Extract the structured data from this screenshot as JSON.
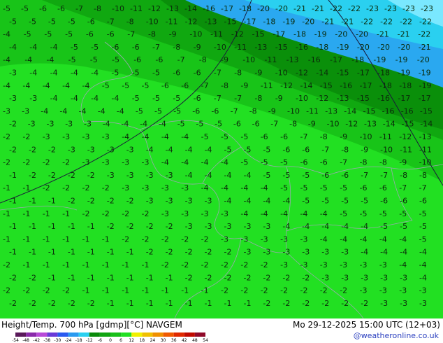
{
  "footer": {
    "title": "Height/Temp. 700 hPa [gdmp][°C] NAVGEM",
    "valid": "Mo 29-12-2025 15:00 UTC (12+03)",
    "credit": "@weatheronline.co.uk"
  },
  "colorbar": {
    "ticks": [
      "-54",
      "-48",
      "-42",
      "-38",
      "-30",
      "-24",
      "-18",
      "-12",
      "-6",
      "0",
      "6",
      "12",
      "18",
      "24",
      "30",
      "36",
      "42",
      "48",
      "54"
    ],
    "colors": [
      "#5a1a5a",
      "#8a2aaa",
      "#b84ad8",
      "#6a3ad8",
      "#2a5af0",
      "#2a9af0",
      "#2ad0f0",
      "#0a8a0a",
      "#11a511",
      "#19c019",
      "#22e022",
      "#f0f000",
      "#f0c000",
      "#f09000",
      "#f05a00",
      "#e02a00",
      "#c00a00",
      "#900a2a"
    ]
  },
  "map": {
    "colors": {
      "green_light": "#22e022",
      "green_mid": "#18c418",
      "green_dark": "#10a810",
      "green_darker": "#0a8f0a",
      "cyan_light": "#7ae8ff",
      "cyan": "#2ad0f0",
      "blue": "#2aa8f0",
      "border": "#9aa8b0",
      "contour": "#1a1a3a"
    },
    "temperature_rows": [
      {
        "values": [
          "-5",
          "-5",
          "-6",
          "-6",
          "-7",
          "-8",
          "-10",
          "-11",
          "-12",
          "-13",
          "-14",
          "-16",
          "-17",
          "-18",
          "-20",
          "-20",
          "-21",
          "-21",
          "-22",
          "-22",
          "-23",
          "-23",
          "-23",
          "-23"
        ]
      },
      {
        "values": [
          "-5",
          "-5",
          "-5",
          "-5",
          "-6",
          "-7",
          "-8",
          "-10",
          "-11",
          "-12",
          "-13",
          "-15",
          "-17",
          "-18",
          "-19",
          "-20",
          "-21",
          "-21",
          "-22",
          "-22",
          "-22",
          "-22"
        ]
      },
      {
        "values": [
          "-4",
          "-5",
          "-5",
          "-5",
          "-6",
          "-6",
          "-7",
          "-8",
          "-9",
          "-10",
          "-11",
          "-12",
          "-15",
          "-17",
          "-18",
          "-19",
          "-20",
          "-20",
          "-21",
          "-21",
          "-22"
        ]
      },
      {
        "values": [
          "-4",
          "-4",
          "-4",
          "-5",
          "-5",
          "-6",
          "-6",
          "-7",
          "-8",
          "-9",
          "-10",
          "-11",
          "-13",
          "-15",
          "-16",
          "-18",
          "-19",
          "-20",
          "-20",
          "-20",
          "-21"
        ]
      },
      {
        "values": [
          "-4",
          "-4",
          "-4",
          "-5",
          "-5",
          "-5",
          "-6",
          "-6",
          "-7",
          "-8",
          "-9",
          "-10",
          "-11",
          "-13",
          "-16",
          "-17",
          "-18",
          "-19",
          "-19",
          "-20"
        ]
      },
      {
        "values": [
          "-3",
          "-4",
          "-4",
          "-4",
          "-4",
          "-5",
          "-5",
          "-5",
          "-6",
          "-6",
          "-7",
          "-8",
          "-9",
          "-10",
          "-12",
          "-14",
          "-15",
          "-17",
          "-18",
          "-19",
          "-19"
        ]
      },
      {
        "values": [
          "-4",
          "-4",
          "-4",
          "-4",
          "-4",
          "-5",
          "-5",
          "-5",
          "-6",
          "-6",
          "-7",
          "-8",
          "-9",
          "-11",
          "-12",
          "-14",
          "-15",
          "-16",
          "-17",
          "-18",
          "-18",
          "-19"
        ]
      },
      {
        "values": [
          "-3",
          "-3",
          "-4",
          "-4",
          "-4",
          "-4",
          "-5",
          "-5",
          "-5",
          "-6",
          "-7",
          "-7",
          "-8",
          "-9",
          "-10",
          "-12",
          "-13",
          "-15",
          "-16",
          "-17",
          "-17"
        ]
      },
      {
        "values": [
          "-3",
          "-3",
          "-4",
          "-4",
          "-4",
          "-4",
          "-4",
          "-5",
          "-5",
          "-5",
          "-6",
          "-6",
          "-7",
          "-8",
          "-9",
          "-10",
          "-11",
          "-13",
          "-14",
          "-15",
          "-16",
          "-16",
          "-15"
        ]
      },
      {
        "values": [
          "-2",
          "-3",
          "-3",
          "-3",
          "-3",
          "-4",
          "-4",
          "-4",
          "-4",
          "-5",
          "-5",
          "-5",
          "-6",
          "-6",
          "-7",
          "-8",
          "-9",
          "-10",
          "-12",
          "-13",
          "-14",
          "-15",
          "-14"
        ]
      },
      {
        "values": [
          "-2",
          "-2",
          "-3",
          "-3",
          "-3",
          "-3",
          "-4",
          "-4",
          "-4",
          "-4",
          "-5",
          "-5",
          "-5",
          "-6",
          "-6",
          "-7",
          "-8",
          "-9",
          "-10",
          "-11",
          "-12",
          "-13"
        ]
      },
      {
        "values": [
          "-2",
          "-2",
          "-2",
          "-3",
          "-3",
          "-3",
          "-3",
          "-4",
          "-4",
          "-4",
          "-4",
          "-5",
          "-5",
          "-5",
          "-6",
          "-6",
          "-7",
          "-8",
          "-9",
          "-10",
          "-11",
          "-11"
        ]
      },
      {
        "values": [
          "-2",
          "-2",
          "-2",
          "-2",
          "-3",
          "-3",
          "-3",
          "-3",
          "-4",
          "-4",
          "-4",
          "-4",
          "-5",
          "-5",
          "-5",
          "-6",
          "-6",
          "-7",
          "-8",
          "-8",
          "-9",
          "-10"
        ]
      },
      {
        "values": [
          "-1",
          "-2",
          "-2",
          "-2",
          "-2",
          "-3",
          "-3",
          "-3",
          "-3",
          "-4",
          "-4",
          "-4",
          "-4",
          "-5",
          "-5",
          "-5",
          "-6",
          "-6",
          "-7",
          "-7",
          "-8",
          "-8"
        ]
      },
      {
        "values": [
          "-1",
          "-1",
          "-2",
          "-2",
          "-2",
          "-2",
          "-3",
          "-3",
          "-3",
          "-3",
          "-4",
          "-4",
          "-4",
          "-4",
          "-5",
          "-5",
          "-5",
          "-5",
          "-6",
          "-6",
          "-7",
          "-7"
        ]
      },
      {
        "values": [
          "-1",
          "-1",
          "-1",
          "-2",
          "-2",
          "-2",
          "-2",
          "-3",
          "-3",
          "-3",
          "-3",
          "-4",
          "-4",
          "-4",
          "-4",
          "-5",
          "-5",
          "-5",
          "-5",
          "-6",
          "-6",
          "-6"
        ]
      },
      {
        "values": [
          "-1",
          "-1",
          "-1",
          "-1",
          "-2",
          "-2",
          "-2",
          "-2",
          "-3",
          "-3",
          "-3",
          "-3",
          "-4",
          "-4",
          "-4",
          "-4",
          "-4",
          "-5",
          "-5",
          "-5",
          "-5",
          "-5"
        ]
      },
      {
        "values": [
          "-1",
          "-1",
          "-1",
          "-1",
          "-1",
          "-2",
          "-2",
          "-2",
          "-2",
          "-3",
          "-3",
          "-3",
          "-3",
          "-3",
          "-4",
          "-4",
          "-4",
          "-4",
          "-4",
          "-5",
          "-5",
          "-5"
        ]
      },
      {
        "values": [
          "-1",
          "-1",
          "-1",
          "-1",
          "-1",
          "-1",
          "-2",
          "-2",
          "-2",
          "-2",
          "-2",
          "-3",
          "-3",
          "-3",
          "-3",
          "-3",
          "-4",
          "-4",
          "-4",
          "-4",
          "-4",
          "-5"
        ]
      },
      {
        "values": [
          "-1",
          "-1",
          "-1",
          "-1",
          "-1",
          "-1",
          "-1",
          "-2",
          "-2",
          "-2",
          "-2",
          "-2",
          "-3",
          "-3",
          "-3",
          "-3",
          "-3",
          "-3",
          "-4",
          "-4",
          "-4",
          "-4"
        ]
      },
      {
        "values": [
          "-2",
          "-1",
          "-1",
          "-1",
          "-1",
          "-1",
          "-1",
          "-1",
          "-2",
          "-2",
          "-2",
          "-2",
          "-2",
          "-2",
          "-3",
          "-3",
          "-3",
          "-3",
          "-3",
          "-3",
          "-4",
          "-4"
        ]
      },
      {
        "values": [
          "-2",
          "-2",
          "-1",
          "-1",
          "-1",
          "-1",
          "-1",
          "-1",
          "-1",
          "-2",
          "-2",
          "-2",
          "-2",
          "-2",
          "-2",
          "-2",
          "-3",
          "-3",
          "-3",
          "-3",
          "-3",
          "-4"
        ]
      },
      {
        "values": [
          "-2",
          "-2",
          "-2",
          "-2",
          "-1",
          "-1",
          "-1",
          "-1",
          "-1",
          "-1",
          "-1",
          "-2",
          "-2",
          "-2",
          "-2",
          "-2",
          "-2",
          "-2",
          "-3",
          "-3",
          "-3",
          "-3"
        ]
      },
      {
        "values": [
          "-2",
          "-2",
          "-2",
          "-2",
          "-2",
          "-1",
          "-1",
          "-1",
          "-1",
          "-1",
          "-1",
          "-1",
          "-1",
          "-2",
          "-2",
          "-2",
          "-2",
          "-2",
          "-2",
          "-3",
          "-3",
          "-3"
        ]
      }
    ]
  }
}
